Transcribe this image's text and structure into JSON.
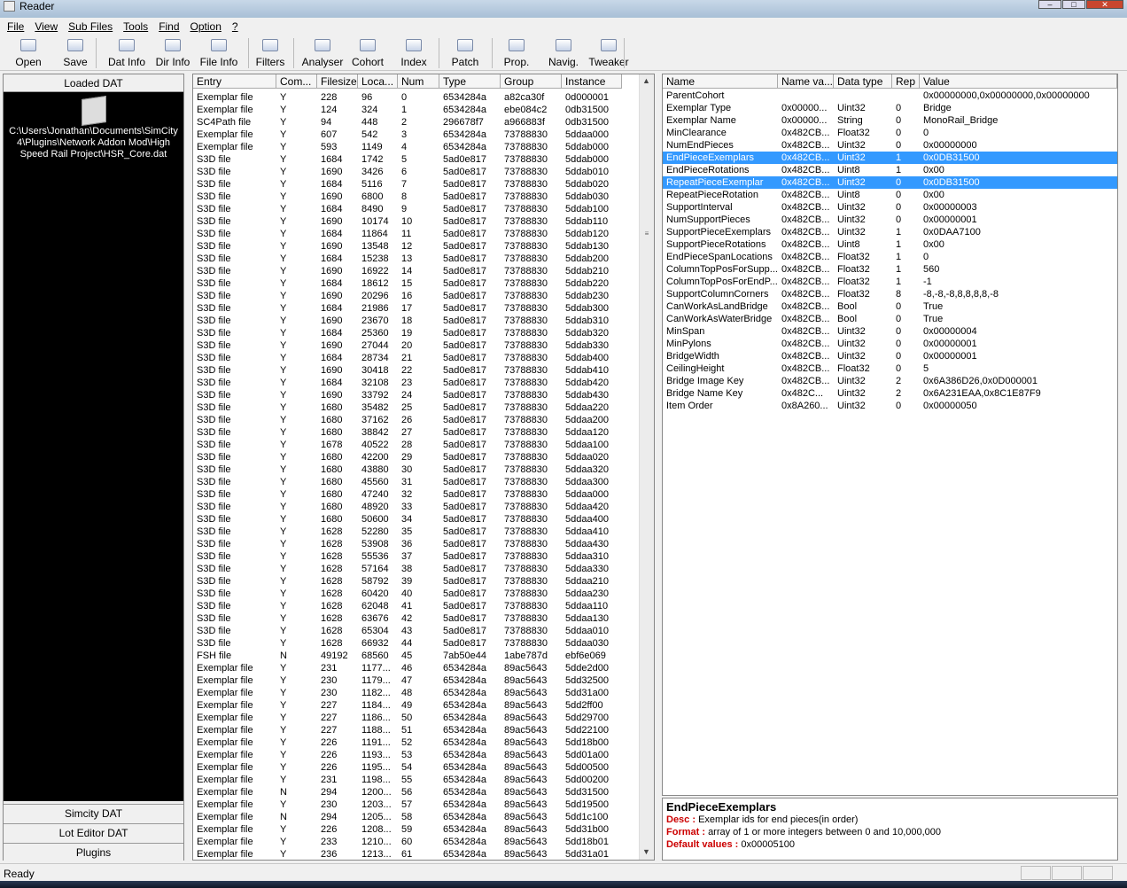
{
  "window": {
    "title": "Reader"
  },
  "menu": [
    "File",
    "View",
    "Sub Files",
    "Tools",
    "Find",
    "Option",
    "?"
  ],
  "toolbar": [
    "Open",
    "Save",
    "Dat Info",
    "Dir Info",
    "File Info",
    "Filters",
    "Analyser",
    "Cohort",
    "Index",
    "Patch",
    "Prop.",
    "Navig.",
    "Tweaker"
  ],
  "left": {
    "header": "Loaded DAT",
    "path": "C:\\Users\\Jonathan\\Documents\\SimCity 4\\Plugins\\Network Addon Mod\\High Speed Rail Project\\HSR_Core.dat",
    "buttons": [
      "Simcity DAT",
      "Lot Editor DAT",
      "Plugins"
    ]
  },
  "files": {
    "columns": [
      "Entry",
      "Com...",
      "Filesize",
      "Loca...",
      "Num",
      "Type",
      "Group",
      "Instance"
    ],
    "rows": [
      [
        "Exemplar file",
        "Y",
        "228",
        "96",
        "0",
        "6534284a",
        "a82ca30f",
        "0d000001"
      ],
      [
        "Exemplar file",
        "Y",
        "124",
        "324",
        "1",
        "6534284a",
        "ebe084c2",
        "0db31500"
      ],
      [
        "SC4Path file",
        "Y",
        "94",
        "448",
        "2",
        "296678f7",
        "a966883f",
        "0db31500"
      ],
      [
        "Exemplar file",
        "Y",
        "607",
        "542",
        "3",
        "6534284a",
        "73788830",
        "5ddaa000"
      ],
      [
        "Exemplar file",
        "Y",
        "593",
        "1149",
        "4",
        "6534284a",
        "73788830",
        "5ddab000"
      ],
      [
        "S3D file",
        "Y",
        "1684",
        "1742",
        "5",
        "5ad0e817",
        "73788830",
        "5ddab000"
      ],
      [
        "S3D file",
        "Y",
        "1690",
        "3426",
        "6",
        "5ad0e817",
        "73788830",
        "5ddab010"
      ],
      [
        "S3D file",
        "Y",
        "1684",
        "5116",
        "7",
        "5ad0e817",
        "73788830",
        "5ddab020"
      ],
      [
        "S3D file",
        "Y",
        "1690",
        "6800",
        "8",
        "5ad0e817",
        "73788830",
        "5ddab030"
      ],
      [
        "S3D file",
        "Y",
        "1684",
        "8490",
        "9",
        "5ad0e817",
        "73788830",
        "5ddab100"
      ],
      [
        "S3D file",
        "Y",
        "1690",
        "10174",
        "10",
        "5ad0e817",
        "73788830",
        "5ddab110"
      ],
      [
        "S3D file",
        "Y",
        "1684",
        "11864",
        "11",
        "5ad0e817",
        "73788830",
        "5ddab120"
      ],
      [
        "S3D file",
        "Y",
        "1690",
        "13548",
        "12",
        "5ad0e817",
        "73788830",
        "5ddab130"
      ],
      [
        "S3D file",
        "Y",
        "1684",
        "15238",
        "13",
        "5ad0e817",
        "73788830",
        "5ddab200"
      ],
      [
        "S3D file",
        "Y",
        "1690",
        "16922",
        "14",
        "5ad0e817",
        "73788830",
        "5ddab210"
      ],
      [
        "S3D file",
        "Y",
        "1684",
        "18612",
        "15",
        "5ad0e817",
        "73788830",
        "5ddab220"
      ],
      [
        "S3D file",
        "Y",
        "1690",
        "20296",
        "16",
        "5ad0e817",
        "73788830",
        "5ddab230"
      ],
      [
        "S3D file",
        "Y",
        "1684",
        "21986",
        "17",
        "5ad0e817",
        "73788830",
        "5ddab300"
      ],
      [
        "S3D file",
        "Y",
        "1690",
        "23670",
        "18",
        "5ad0e817",
        "73788830",
        "5ddab310"
      ],
      [
        "S3D file",
        "Y",
        "1684",
        "25360",
        "19",
        "5ad0e817",
        "73788830",
        "5ddab320"
      ],
      [
        "S3D file",
        "Y",
        "1690",
        "27044",
        "20",
        "5ad0e817",
        "73788830",
        "5ddab330"
      ],
      [
        "S3D file",
        "Y",
        "1684",
        "28734",
        "21",
        "5ad0e817",
        "73788830",
        "5ddab400"
      ],
      [
        "S3D file",
        "Y",
        "1690",
        "30418",
        "22",
        "5ad0e817",
        "73788830",
        "5ddab410"
      ],
      [
        "S3D file",
        "Y",
        "1684",
        "32108",
        "23",
        "5ad0e817",
        "73788830",
        "5ddab420"
      ],
      [
        "S3D file",
        "Y",
        "1690",
        "33792",
        "24",
        "5ad0e817",
        "73788830",
        "5ddab430"
      ],
      [
        "S3D file",
        "Y",
        "1680",
        "35482",
        "25",
        "5ad0e817",
        "73788830",
        "5ddaa220"
      ],
      [
        "S3D file",
        "Y",
        "1680",
        "37162",
        "26",
        "5ad0e817",
        "73788830",
        "5ddaa200"
      ],
      [
        "S3D file",
        "Y",
        "1680",
        "38842",
        "27",
        "5ad0e817",
        "73788830",
        "5ddaa120"
      ],
      [
        "S3D file",
        "Y",
        "1678",
        "40522",
        "28",
        "5ad0e817",
        "73788830",
        "5ddaa100"
      ],
      [
        "S3D file",
        "Y",
        "1680",
        "42200",
        "29",
        "5ad0e817",
        "73788830",
        "5ddaa020"
      ],
      [
        "S3D file",
        "Y",
        "1680",
        "43880",
        "30",
        "5ad0e817",
        "73788830",
        "5ddaa320"
      ],
      [
        "S3D file",
        "Y",
        "1680",
        "45560",
        "31",
        "5ad0e817",
        "73788830",
        "5ddaa300"
      ],
      [
        "S3D file",
        "Y",
        "1680",
        "47240",
        "32",
        "5ad0e817",
        "73788830",
        "5ddaa000"
      ],
      [
        "S3D file",
        "Y",
        "1680",
        "48920",
        "33",
        "5ad0e817",
        "73788830",
        "5ddaa420"
      ],
      [
        "S3D file",
        "Y",
        "1680",
        "50600",
        "34",
        "5ad0e817",
        "73788830",
        "5ddaa400"
      ],
      [
        "S3D file",
        "Y",
        "1628",
        "52280",
        "35",
        "5ad0e817",
        "73788830",
        "5ddaa410"
      ],
      [
        "S3D file",
        "Y",
        "1628",
        "53908",
        "36",
        "5ad0e817",
        "73788830",
        "5ddaa430"
      ],
      [
        "S3D file",
        "Y",
        "1628",
        "55536",
        "37",
        "5ad0e817",
        "73788830",
        "5ddaa310"
      ],
      [
        "S3D file",
        "Y",
        "1628",
        "57164",
        "38",
        "5ad0e817",
        "73788830",
        "5ddaa330"
      ],
      [
        "S3D file",
        "Y",
        "1628",
        "58792",
        "39",
        "5ad0e817",
        "73788830",
        "5ddaa210"
      ],
      [
        "S3D file",
        "Y",
        "1628",
        "60420",
        "40",
        "5ad0e817",
        "73788830",
        "5ddaa230"
      ],
      [
        "S3D file",
        "Y",
        "1628",
        "62048",
        "41",
        "5ad0e817",
        "73788830",
        "5ddaa110"
      ],
      [
        "S3D file",
        "Y",
        "1628",
        "63676",
        "42",
        "5ad0e817",
        "73788830",
        "5ddaa130"
      ],
      [
        "S3D file",
        "Y",
        "1628",
        "65304",
        "43",
        "5ad0e817",
        "73788830",
        "5ddaa010"
      ],
      [
        "S3D file",
        "Y",
        "1628",
        "66932",
        "44",
        "5ad0e817",
        "73788830",
        "5ddaa030"
      ],
      [
        "FSH file",
        "N",
        "49192",
        "68560",
        "45",
        "7ab50e44",
        "1abe787d",
        "ebf6e069"
      ],
      [
        "Exemplar file",
        "Y",
        "231",
        "1177...",
        "46",
        "6534284a",
        "89ac5643",
        "5dde2d00"
      ],
      [
        "Exemplar file",
        "Y",
        "230",
        "1179...",
        "47",
        "6534284a",
        "89ac5643",
        "5dd32500"
      ],
      [
        "Exemplar file",
        "Y",
        "230",
        "1182...",
        "48",
        "6534284a",
        "89ac5643",
        "5dd31a00"
      ],
      [
        "Exemplar file",
        "Y",
        "227",
        "1184...",
        "49",
        "6534284a",
        "89ac5643",
        "5dd2ff00"
      ],
      [
        "Exemplar file",
        "Y",
        "227",
        "1186...",
        "50",
        "6534284a",
        "89ac5643",
        "5dd29700"
      ],
      [
        "Exemplar file",
        "Y",
        "227",
        "1188...",
        "51",
        "6534284a",
        "89ac5643",
        "5dd22100"
      ],
      [
        "Exemplar file",
        "Y",
        "226",
        "1191...",
        "52",
        "6534284a",
        "89ac5643",
        "5dd18b00"
      ],
      [
        "Exemplar file",
        "Y",
        "226",
        "1193...",
        "53",
        "6534284a",
        "89ac5643",
        "5dd01a00"
      ],
      [
        "Exemplar file",
        "Y",
        "226",
        "1195...",
        "54",
        "6534284a",
        "89ac5643",
        "5dd00500"
      ],
      [
        "Exemplar file",
        "Y",
        "231",
        "1198...",
        "55",
        "6534284a",
        "89ac5643",
        "5dd00200"
      ],
      [
        "Exemplar file",
        "N",
        "294",
        "1200...",
        "56",
        "6534284a",
        "89ac5643",
        "5dd31500"
      ],
      [
        "Exemplar file",
        "Y",
        "230",
        "1203...",
        "57",
        "6534284a",
        "89ac5643",
        "5dd19500"
      ],
      [
        "Exemplar file",
        "N",
        "294",
        "1205...",
        "58",
        "6534284a",
        "89ac5643",
        "5dd1c100"
      ],
      [
        "Exemplar file",
        "Y",
        "226",
        "1208...",
        "59",
        "6534284a",
        "89ac5643",
        "5dd31b00"
      ],
      [
        "Exemplar file",
        "Y",
        "233",
        "1210...",
        "60",
        "6534284a",
        "89ac5643",
        "5dd18b01"
      ],
      [
        "Exemplar file",
        "Y",
        "236",
        "1213...",
        "61",
        "6534284a",
        "89ac5643",
        "5dd31a01"
      ]
    ]
  },
  "props": {
    "columns": [
      "Name",
      "Name va...",
      "Data type",
      "Rep",
      "Value"
    ],
    "rows": [
      [
        "ParentCohort",
        "",
        "",
        "",
        "0x00000000,0x00000000,0x00000000"
      ],
      [
        "Exemplar Type",
        "0x00000...",
        "Uint32",
        "0",
        "Bridge"
      ],
      [
        "Exemplar Name",
        "0x00000...",
        "String",
        "0",
        "MonoRail_Bridge"
      ],
      [
        "MinClearance",
        "0x482CB...",
        "Float32",
        "0",
        "0"
      ],
      [
        "NumEndPieces",
        "0x482CB...",
        "Uint32",
        "0",
        "0x00000000"
      ],
      [
        "EndPieceExemplars",
        "0x482CB...",
        "Uint32",
        "1",
        "0x0DB31500"
      ],
      [
        "EndPieceRotations",
        "0x482CB...",
        "Uint8",
        "1",
        "0x00"
      ],
      [
        "RepeatPieceExemplar",
        "0x482CB...",
        "Uint32",
        "0",
        "0x0DB31500"
      ],
      [
        "RepeatPieceRotation",
        "0x482CB...",
        "Uint8",
        "0",
        "0x00"
      ],
      [
        "SupportInterval",
        "0x482CB...",
        "Uint32",
        "0",
        "0x00000003"
      ],
      [
        "NumSupportPieces",
        "0x482CB...",
        "Uint32",
        "0",
        "0x00000001"
      ],
      [
        "SupportPieceExemplars",
        "0x482CB...",
        "Uint32",
        "1",
        "0x0DAA7100"
      ],
      [
        "SupportPieceRotations",
        "0x482CB...",
        "Uint8",
        "1",
        "0x00"
      ],
      [
        "EndPieceSpanLocations",
        "0x482CB...",
        "Float32",
        "1",
        "0"
      ],
      [
        "ColumnTopPosForSupp...",
        "0x482CB...",
        "Float32",
        "1",
        "560"
      ],
      [
        "ColumnTopPosForEndP...",
        "0x482CB...",
        "Float32",
        "1",
        "-1"
      ],
      [
        "SupportColumnCorners",
        "0x482CB...",
        "Float32",
        "8",
        "-8,-8,-8,8,8,8,8,-8"
      ],
      [
        "CanWorkAsLandBridge",
        "0x482CB...",
        "Bool",
        "0",
        "True"
      ],
      [
        "CanWorkAsWaterBridge",
        "0x482CB...",
        "Bool",
        "0",
        "True"
      ],
      [
        "MinSpan",
        "0x482CB...",
        "Uint32",
        "0",
        "0x00000004"
      ],
      [
        "MinPylons",
        "0x482CB...",
        "Uint32",
        "0",
        "0x00000001"
      ],
      [
        "BridgeWidth",
        "0x482CB...",
        "Uint32",
        "0",
        "0x00000001"
      ],
      [
        "CeilingHeight",
        "0x482CB...",
        "Float32",
        "0",
        "5"
      ],
      [
        "Bridge Image Key",
        "0x482CB...",
        "Uint32",
        "2",
        "0x6A386D26,0x0D000001"
      ],
      [
        "Bridge Name Key",
        "0x482C...",
        "Uint32",
        "2",
        "0x6A231EAA,0x8C1E87F9"
      ],
      [
        "Item Order",
        "0x8A260...",
        "Uint32",
        "0",
        "0x00000050"
      ]
    ],
    "selected": [
      5,
      7
    ]
  },
  "desc": {
    "title": "EndPieceExemplars",
    "desc_label": "Desc :",
    "desc": "Exemplar ids for end pieces(in order)",
    "format_label": "Format :",
    "format": "array of 1 or more integers between 0 and 10,000,000",
    "default_label": "Default values :",
    "default": "0x00005100"
  },
  "status": "Ready"
}
